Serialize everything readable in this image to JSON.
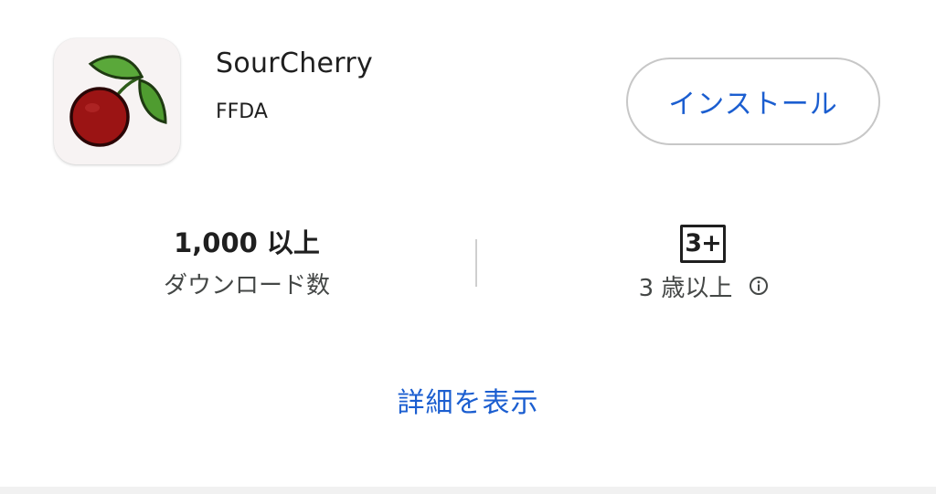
{
  "app": {
    "name": "SourCherry",
    "developer": "FFDA",
    "icon": "cherry-icon"
  },
  "install": {
    "label": "インストール"
  },
  "stats": {
    "downloads": {
      "value": "1,000 以上",
      "label": "ダウンロード数"
    },
    "rating": {
      "badge": "3+",
      "label": "3 歳以上",
      "info_icon": "info-icon"
    }
  },
  "details": {
    "label": "詳細を表示"
  },
  "colors": {
    "accent": "#1b5ed0",
    "text_primary": "#1f1f1f",
    "text_secondary": "#444746",
    "border": "#c7c7c7",
    "cherry_red": "#9b1414",
    "leaf_green": "#4a9a2c"
  }
}
